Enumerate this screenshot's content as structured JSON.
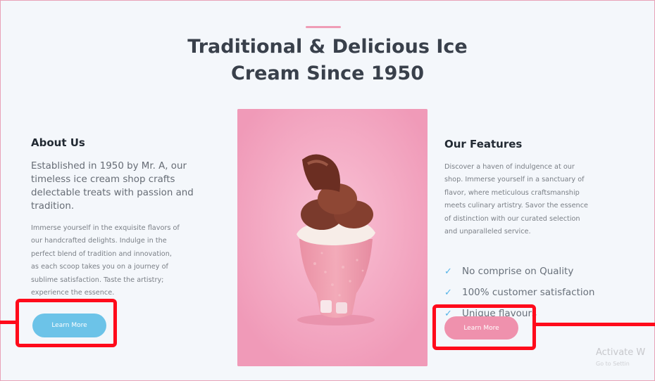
{
  "hero": {
    "title_line1": "Traditional & Delicious Ice",
    "title_line2": "Cream Since 1950"
  },
  "about": {
    "heading": "About Us",
    "lead_lines": [
      "Established in 1950 by Mr. A, our",
      "timeless ice cream shop crafts",
      "delectable treats with passion and",
      "tradition."
    ],
    "body_lines": [
      "Immerse yourself in the exquisite flavors of",
      "our handcrafted delights. Indulge in the",
      "perfect blend of tradition and innovation,",
      "as each scoop takes you on a journey of",
      "sublime satisfaction. Taste the artistry;",
      "experience the essence."
    ],
    "button_label": "Learn More"
  },
  "features": {
    "heading": "Our Features",
    "body_lines": [
      "Discover a haven of indulgence at our",
      "shop. Immerse yourself in a sanctuary of",
      "flavor, where meticulous craftsmanship",
      "meets culinary artistry. Savor the essence",
      "of distinction with our curated selection",
      "and unparalleled service."
    ],
    "items": [
      "No comprise on Quality",
      "100% customer satisfaction",
      "Unique flavours"
    ],
    "check_icon": "checkmark-icon",
    "button_label": "Learn More"
  },
  "watermark": {
    "line1": "Activate W",
    "line2": "Go to Settin"
  },
  "colors": {
    "accent_pink": "#ef91ad",
    "accent_blue": "#6cc3e8",
    "highlight_red": "#ff0b1b"
  }
}
